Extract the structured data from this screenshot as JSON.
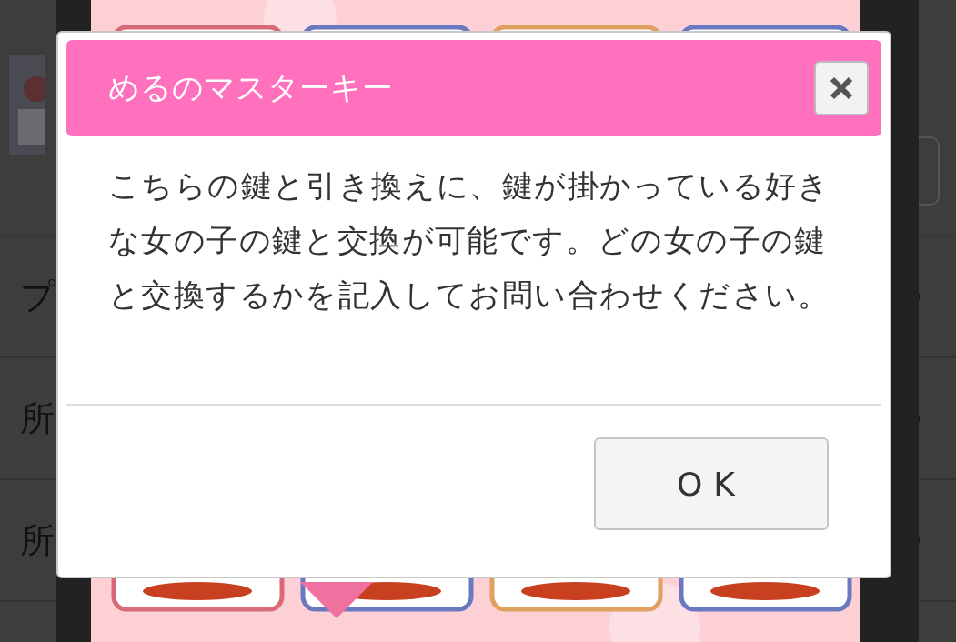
{
  "background_list": {
    "rows": [
      {
        "label": "プ"
      },
      {
        "label": "所"
      },
      {
        "label": "所"
      }
    ]
  },
  "dialog": {
    "title": "めるのマスターキー",
    "message": "こちらの鍵と引き換えに、鍵が掛かっている好きな女の子の鍵と交換が可能です。どの女の子の鍵と交換するかを記入してお問い合わせください。",
    "buttons": [
      {
        "label": "OK"
      }
    ]
  }
}
